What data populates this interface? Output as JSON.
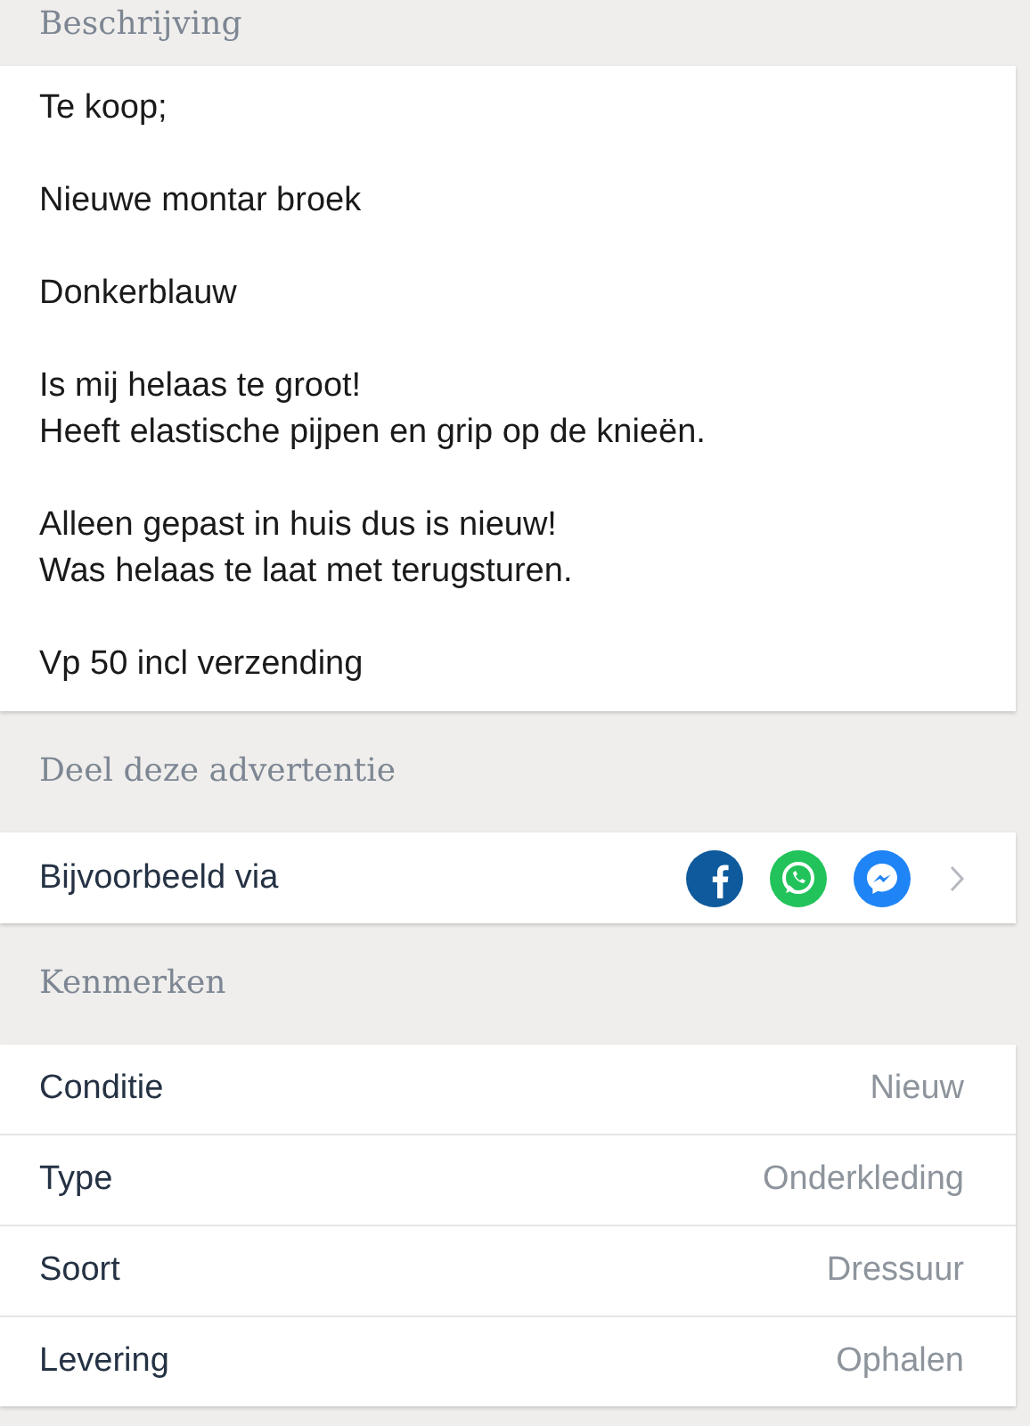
{
  "description": {
    "title": "Beschrijving",
    "paragraphs": [
      [
        "Te koop;"
      ],
      [
        "Nieuwe montar broek"
      ],
      [
        "Donkerblauw"
      ],
      [
        "Is mij helaas te groot!",
        "Heeft elastische pijpen en grip op de knieën."
      ],
      [
        "Alleen gepast in huis dus is nieuw!",
        "Was helaas te laat met terugsturen."
      ],
      [
        "Vp 50 incl verzending"
      ]
    ]
  },
  "share": {
    "title": "Deel deze advertentie",
    "label": "Bijvoorbeeld via",
    "services": [
      {
        "kind": "facebook"
      },
      {
        "kind": "whatsapp"
      },
      {
        "kind": "messenger"
      }
    ]
  },
  "features": {
    "title": "Kenmerken",
    "rows": [
      {
        "label": "Conditie",
        "value": "Nieuw"
      },
      {
        "label": "Type",
        "value": "Onderkleding"
      },
      {
        "label": "Soort",
        "value": "Dressuur"
      },
      {
        "label": "Levering",
        "value": "Ophalen"
      }
    ]
  }
}
